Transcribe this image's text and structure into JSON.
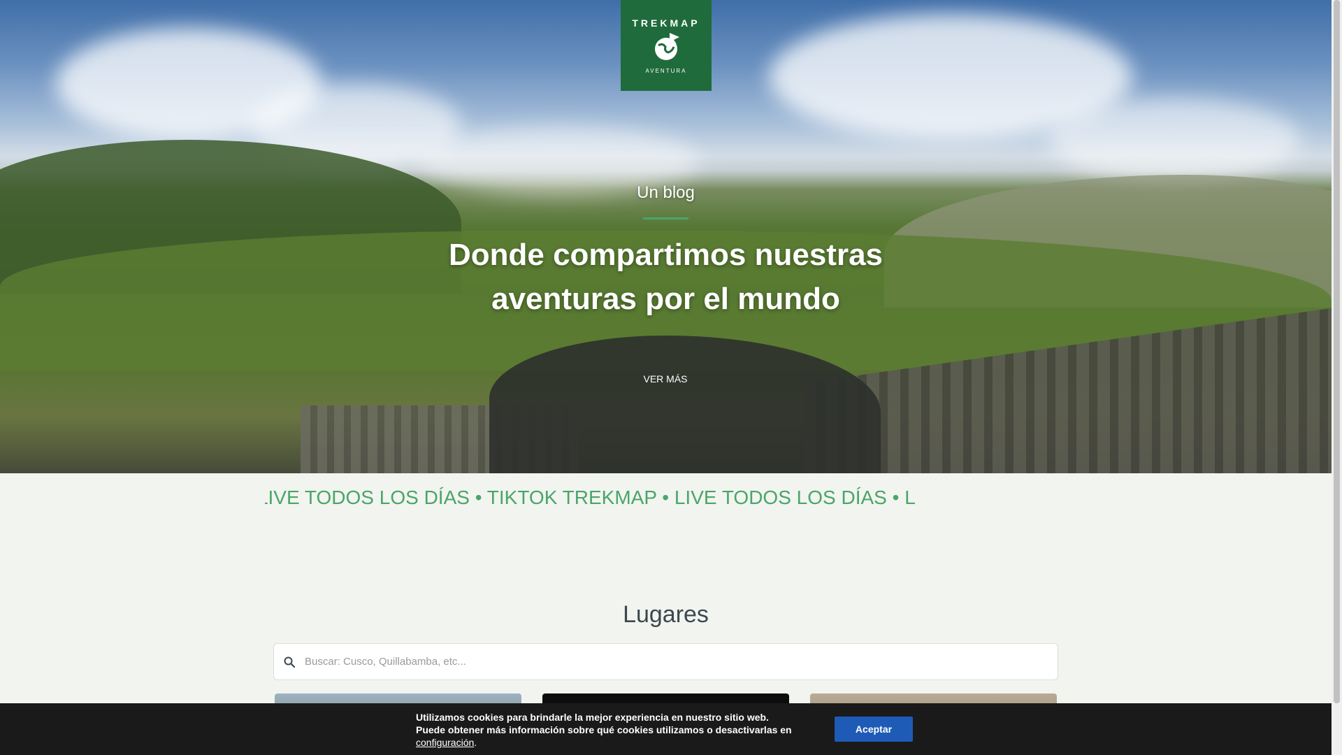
{
  "hero": {
    "logo": {
      "top_text": "TREKMAP",
      "bottom_text": "AVENTURA",
      "icon": "globe-plane-icon"
    },
    "subtitle": "Un blog",
    "title_line1": "Donde compartimos nuestras",
    "title_line2": "aventuras por el mundo",
    "button_label": "VER MÁS"
  },
  "marquee": {
    "text": "OS DÍAS • LIVE TODOS LOS DÍAS • TIKTOK TREKMAP • LIVE TODOS LOS DÍAS • L"
  },
  "lugares": {
    "title": "Lugares",
    "search_placeholder": "Buscar: Cusco, Quillabamba, etc...",
    "search_icon": "search-icon"
  },
  "cookie": {
    "line1": "Utilizamos cookies para brindarle la mejor experiencia en nuestro sitio web.",
    "line2": "Puede obtener más información sobre qué cookies utilizamos o desactivarlas en",
    "link": "configuración",
    "after_link": ".",
    "accept_label": "Aceptar"
  },
  "colors": {
    "brand_green": "#1f6b3c",
    "accent_green": "#4aa56a",
    "accept_blue": "#1e5bb6"
  }
}
